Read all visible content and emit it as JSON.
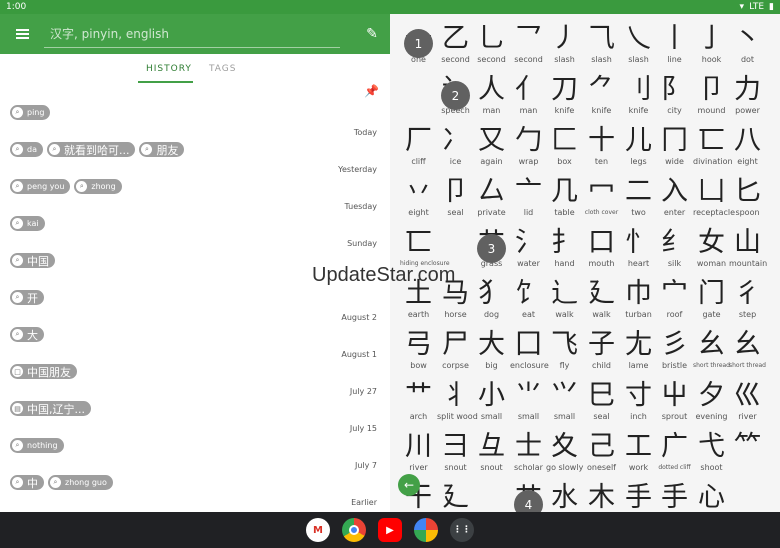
{
  "status_bar": {
    "time": "1:00",
    "network": "LTE"
  },
  "app_bar": {
    "search_placeholder": "汉字, pinyin, english"
  },
  "tabs": [
    {
      "label": "HISTORY",
      "active": true
    },
    {
      "label": "TAGS",
      "active": false
    }
  ],
  "history": [
    {
      "chips": [
        {
          "text": "ping",
          "icon": "search-icon",
          "size": "small"
        }
      ],
      "date": "Today"
    },
    {
      "chips": [
        {
          "text": "da",
          "icon": "search-icon",
          "size": "small"
        },
        {
          "text": "就看到哈可...",
          "icon": "search-icon",
          "size": "big"
        },
        {
          "text": "朋友",
          "icon": "search-icon",
          "size": "big"
        }
      ],
      "date": "Yesterday"
    },
    {
      "chips": [
        {
          "text": "peng you",
          "icon": "search-icon",
          "size": "small"
        },
        {
          "text": "zhong",
          "icon": "search-icon",
          "size": "small"
        }
      ],
      "date": "Tuesday"
    },
    {
      "chips": [
        {
          "text": "kai",
          "icon": "search-icon",
          "size": "small"
        }
      ],
      "date": "Sunday"
    },
    {
      "chips": [
        {
          "text": "中国",
          "icon": "search-icon",
          "size": "big"
        }
      ],
      "date": ""
    },
    {
      "chips": [
        {
          "text": "开",
          "icon": "search-icon",
          "size": "big"
        }
      ],
      "date": "August 2"
    },
    {
      "chips": [
        {
          "text": "大",
          "icon": "search-icon",
          "size": "big"
        }
      ],
      "date": "August 1"
    },
    {
      "chips": [
        {
          "text": "中国朋友",
          "icon": "square-icon",
          "size": "big"
        }
      ],
      "date": "July 27"
    },
    {
      "chips": [
        {
          "text": "中国,辽宁...",
          "icon": "copy-icon",
          "size": "big"
        }
      ],
      "date": "July 15"
    },
    {
      "chips": [
        {
          "text": "nothing",
          "icon": "search-icon",
          "size": "small"
        }
      ],
      "date": "July 7"
    },
    {
      "chips": [
        {
          "text": "中",
          "icon": "search-icon",
          "size": "big"
        },
        {
          "text": "zhong guo",
          "icon": "search-icon",
          "size": "small"
        }
      ],
      "date": "Earlier"
    }
  ],
  "radicals": [
    [
      "一",
      "one"
    ],
    [
      "乙",
      "second"
    ],
    [
      "乚",
      "second"
    ],
    [
      "乛",
      "second"
    ],
    [
      "丿",
      "slash"
    ],
    [
      "⺄",
      "slash"
    ],
    [
      "乀",
      "slash"
    ],
    [
      "丨",
      "line"
    ],
    [
      "亅",
      "hook"
    ],
    [
      "丶",
      "dot"
    ],
    [
      "",
      ""
    ],
    [
      "讠",
      "speech"
    ],
    [
      "人",
      "man"
    ],
    [
      "亻",
      "man"
    ],
    [
      "刀",
      "knife"
    ],
    [
      "⺈",
      "knife"
    ],
    [
      "刂",
      "knife"
    ],
    [
      "阝",
      "city"
    ],
    [
      "卩",
      "mound"
    ],
    [
      "力",
      "power"
    ],
    [
      "厂",
      "cliff"
    ],
    [
      "冫",
      "ice"
    ],
    [
      "又",
      "again"
    ],
    [
      "勹",
      "wrap"
    ],
    [
      "匚",
      "box"
    ],
    [
      "十",
      "ten"
    ],
    [
      "儿",
      "legs"
    ],
    [
      "冂",
      "wide"
    ],
    [
      "匸",
      "divination"
    ],
    [
      "八",
      "eight"
    ],
    [
      "丷",
      "eight"
    ],
    [
      "卩",
      "seal"
    ],
    [
      "厶",
      "private"
    ],
    [
      "亠",
      "lid"
    ],
    [
      "几",
      "table"
    ],
    [
      "冖",
      "cloth cover"
    ],
    [
      "二",
      "two"
    ],
    [
      "入",
      "enter"
    ],
    [
      "凵",
      "receptacle"
    ],
    [
      "匕",
      "spoon"
    ],
    [
      "匸",
      "hiding enclosure"
    ],
    [
      "",
      ""
    ],
    [
      "艹",
      "grass"
    ],
    [
      "氵",
      "water"
    ],
    [
      "扌",
      "hand"
    ],
    [
      "口",
      "mouth"
    ],
    [
      "忄",
      "heart"
    ],
    [
      "纟",
      "silk"
    ],
    [
      "女",
      "woman"
    ],
    [
      "山",
      "mountain"
    ],
    [
      "土",
      "earth"
    ],
    [
      "马",
      "horse"
    ],
    [
      "犭",
      "dog"
    ],
    [
      "饣",
      "eat"
    ],
    [
      "辶",
      "walk"
    ],
    [
      "廴",
      "walk"
    ],
    [
      "巾",
      "turban"
    ],
    [
      "宀",
      "roof"
    ],
    [
      "门",
      "gate"
    ],
    [
      "彳",
      "step"
    ],
    [
      "弓",
      "bow"
    ],
    [
      "尸",
      "corpse"
    ],
    [
      "大",
      "big"
    ],
    [
      "囗",
      "enclosure"
    ],
    [
      "飞",
      "fly"
    ],
    [
      "子",
      "child"
    ],
    [
      "尢",
      "lame"
    ],
    [
      "彡",
      "bristle"
    ],
    [
      "幺",
      "short thread"
    ],
    [
      "幺",
      "short thread"
    ],
    [
      "艹",
      "arch"
    ],
    [
      "丬",
      "split wood"
    ],
    [
      "小",
      "small"
    ],
    [
      "⺌",
      "small"
    ],
    [
      "⺍",
      "small"
    ],
    [
      "巳",
      "seal"
    ],
    [
      "寸",
      "inch"
    ],
    [
      "屮",
      "sprout"
    ],
    [
      "夕",
      "evening"
    ],
    [
      "巛",
      "river"
    ],
    [
      "川",
      "river"
    ],
    [
      "彐",
      "snout"
    ],
    [
      "彑",
      "snout"
    ],
    [
      "士",
      "scholar"
    ],
    [
      "夊",
      "go slowly"
    ],
    [
      "己",
      "oneself"
    ],
    [
      "工",
      "work"
    ],
    [
      "广",
      "dotted cliff"
    ],
    [
      "弋",
      "shoot"
    ],
    [
      "⺮",
      ""
    ],
    [
      "干",
      ""
    ],
    [
      "廴",
      ""
    ],
    [
      "",
      ""
    ],
    [
      "艹",
      ""
    ],
    [
      "水",
      ""
    ],
    [
      "木",
      ""
    ],
    [
      "手",
      ""
    ],
    [
      "手",
      ""
    ],
    [
      "心",
      ""
    ]
  ],
  "section_numbers": [
    "1",
    "2",
    "3",
    "4"
  ],
  "watermark": "UpdateStar.com",
  "dock_apps": [
    "gmail-icon",
    "chrome-icon",
    "youtube-icon",
    "photos-icon",
    "app-drawer-icon"
  ]
}
